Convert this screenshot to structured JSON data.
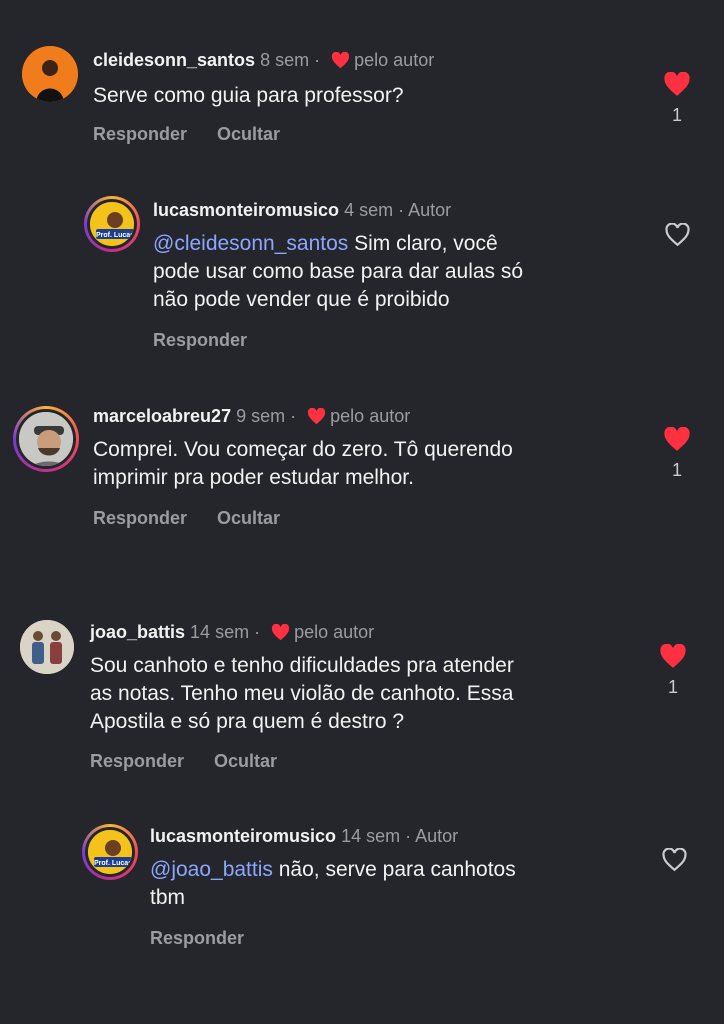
{
  "colors": {
    "background": "#25262b",
    "liked": "#ff3040",
    "mention": "#8ba6ff",
    "meta": "#9a9ca3"
  },
  "comments": [
    {
      "username": "cleidesonn_santos",
      "time": "8 sem",
      "liked_by_author_label": "pelo autor",
      "text": "Serve como guia para professor?",
      "actions": [
        "Responder",
        "Ocultar"
      ],
      "likes": "1",
      "liked": true,
      "avatar_icon": "user-avatar-icon"
    },
    {
      "username": "lucasmonteiromusico",
      "time": "4 sem",
      "author_label": "Autor",
      "mention": "@cleidesonn_santos",
      "text_line1": " Sim claro, você",
      "text_line2": "pode usar como base para dar aulas só",
      "text_line3": "não pode vender que é proibido",
      "actions": [
        "Responder"
      ],
      "liked": false,
      "avatar_text": "Prof. Lucas"
    },
    {
      "username": "marceloabreu27",
      "time": "9 sem",
      "liked_by_author_label": "pelo autor",
      "text_line1": "Comprei. Vou começar do zero. Tô querendo",
      "text_line2": "imprimir pra poder estudar melhor.",
      "actions": [
        "Responder",
        "Ocultar"
      ],
      "likes": "1",
      "liked": true
    },
    {
      "username": "joao_battis",
      "time": "14 sem",
      "liked_by_author_label": "pelo autor",
      "text_line1": "Sou canhoto e tenho dificuldades pra atender",
      "text_line2": "as notas. Tenho meu violão de canhoto. Essa",
      "text_line3": "Apostila e só pra quem é destro ?",
      "actions": [
        "Responder",
        "Ocultar"
      ],
      "likes": "1",
      "liked": true
    },
    {
      "username": "lucasmonteiromusico",
      "time": "14 sem",
      "author_label": "Autor",
      "mention": "@joao_battis",
      "text_line1": " não, serve para canhotos",
      "text_line2": "tbm",
      "actions": [
        "Responder"
      ],
      "liked": false,
      "avatar_text": "Prof. Lucas"
    }
  ]
}
